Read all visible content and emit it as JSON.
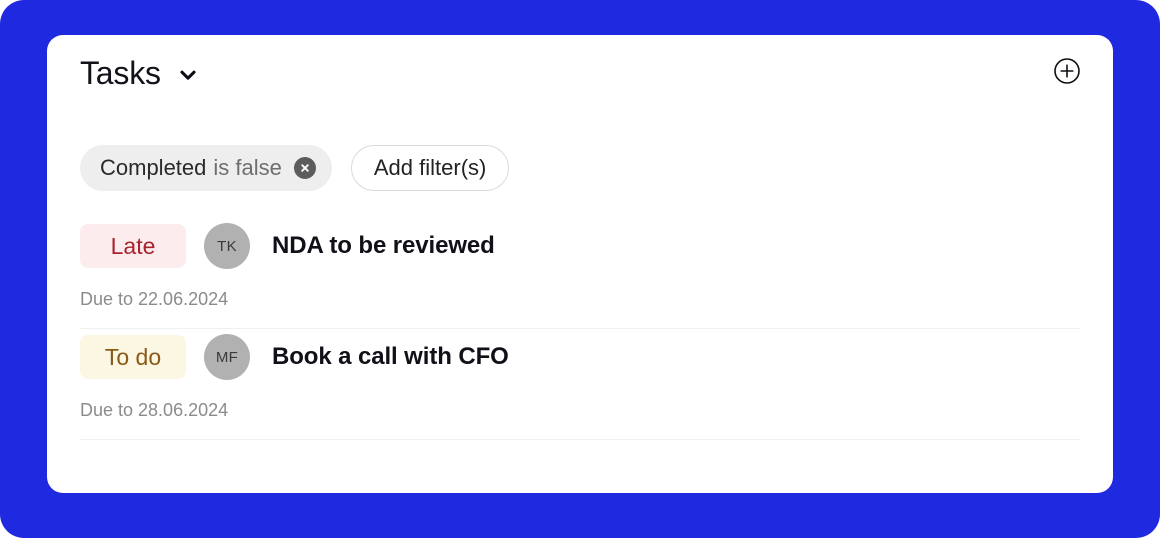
{
  "theme": {
    "backdrop_color": "#1f29e0",
    "card_color": "#ffffff",
    "chip_bg": "#eeeeee",
    "divider_color": "#f0f0f0",
    "avatar_bg": "#b1b1b1",
    "late_bg": "#fcecee",
    "late_text": "#a8232f",
    "todo_bg": "#fbf7e3",
    "todo_text": "#8a5a18"
  },
  "header": {
    "title": "Tasks",
    "dropdown_icon": "chevron-down-icon",
    "add_icon": "plus-circle-icon"
  },
  "filters": {
    "active": {
      "key": "Completed",
      "value": "is false",
      "remove_icon": "close-circle-icon"
    },
    "add_label": "Add filter(s)"
  },
  "tasks": [
    {
      "status": "Late",
      "status_kind": "late",
      "assignee_initials": "TK",
      "title": "NDA to be reviewed",
      "due": "Due to 22.06.2024"
    },
    {
      "status": "To do",
      "status_kind": "todo",
      "assignee_initials": "MF",
      "title": "Book a call with CFO",
      "due": "Due to 28.06.2024"
    }
  ]
}
